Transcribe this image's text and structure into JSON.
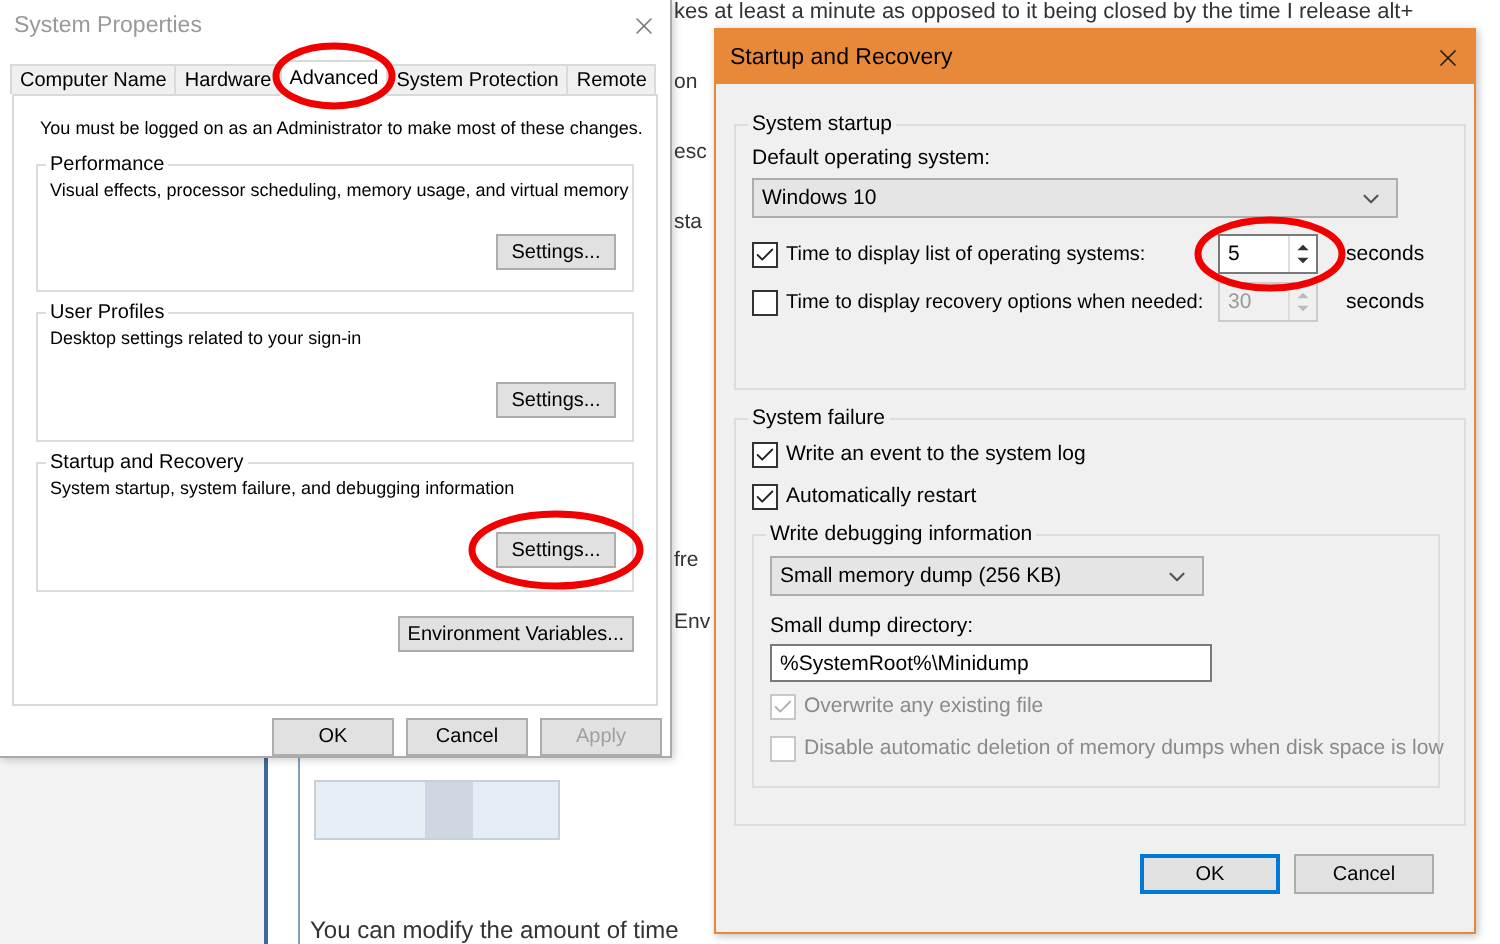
{
  "background_page": {
    "top_line": "kes at least a minute as opposed to it being closed by the time I release alt+",
    "fragments": [
      "on",
      "esc",
      "sta",
      "fre",
      "Env"
    ],
    "paragraph": "You can modify the amount of time"
  },
  "system_properties": {
    "title": "System Properties",
    "tabs": [
      {
        "label": "Computer Name",
        "selected": false
      },
      {
        "label": "Hardware",
        "selected": false
      },
      {
        "label": "Advanced",
        "selected": true
      },
      {
        "label": "System Protection",
        "selected": false
      },
      {
        "label": "Remote",
        "selected": false
      }
    ],
    "notice": "You must be logged on as an Administrator to make most of these changes.",
    "groups": [
      {
        "title": "Performance",
        "description": "Visual effects, processor scheduling, memory usage, and virtual memory",
        "button": "Settings..."
      },
      {
        "title": "User Profiles",
        "description": "Desktop settings related to your sign-in",
        "button": "Settings..."
      },
      {
        "title": "Startup and Recovery",
        "description": "System startup, system failure, and debugging information",
        "button": "Settings..."
      }
    ],
    "env_button": "Environment Variables...",
    "buttons": [
      {
        "label": "OK",
        "disabled": false
      },
      {
        "label": "Cancel",
        "disabled": false
      },
      {
        "label": "Apply",
        "disabled": true
      }
    ]
  },
  "startup_recovery": {
    "title": "Startup and Recovery",
    "system_startup": {
      "title": "System startup",
      "default_os_label": "Default operating system:",
      "default_os": "Windows 10",
      "timers": [
        {
          "label": "Time to display list of operating systems:",
          "checked": true,
          "value": "5",
          "unit": "seconds",
          "disabled": false
        },
        {
          "label": "Time to display recovery options when needed:",
          "checked": false,
          "value": "30",
          "unit": "seconds",
          "disabled": true
        }
      ]
    },
    "system_failure": {
      "title": "System failure",
      "options": [
        {
          "label": "Write an event to the system log",
          "checked": true
        },
        {
          "label": "Automatically restart",
          "checked": true
        }
      ],
      "debug": {
        "title": "Write debugging information",
        "dump_type": "Small memory dump (256 KB)",
        "dir_label": "Small dump directory:",
        "dir_value": "%SystemRoot%\\Minidump",
        "options": [
          {
            "label": "Overwrite any existing file",
            "checked": true,
            "disabled": true
          },
          {
            "label": "Disable automatic deletion of memory dumps when disk space is low",
            "checked": false,
            "disabled": true
          }
        ]
      }
    },
    "buttons": [
      {
        "label": "OK",
        "default": true
      },
      {
        "label": "Cancel",
        "default": false
      }
    ]
  }
}
